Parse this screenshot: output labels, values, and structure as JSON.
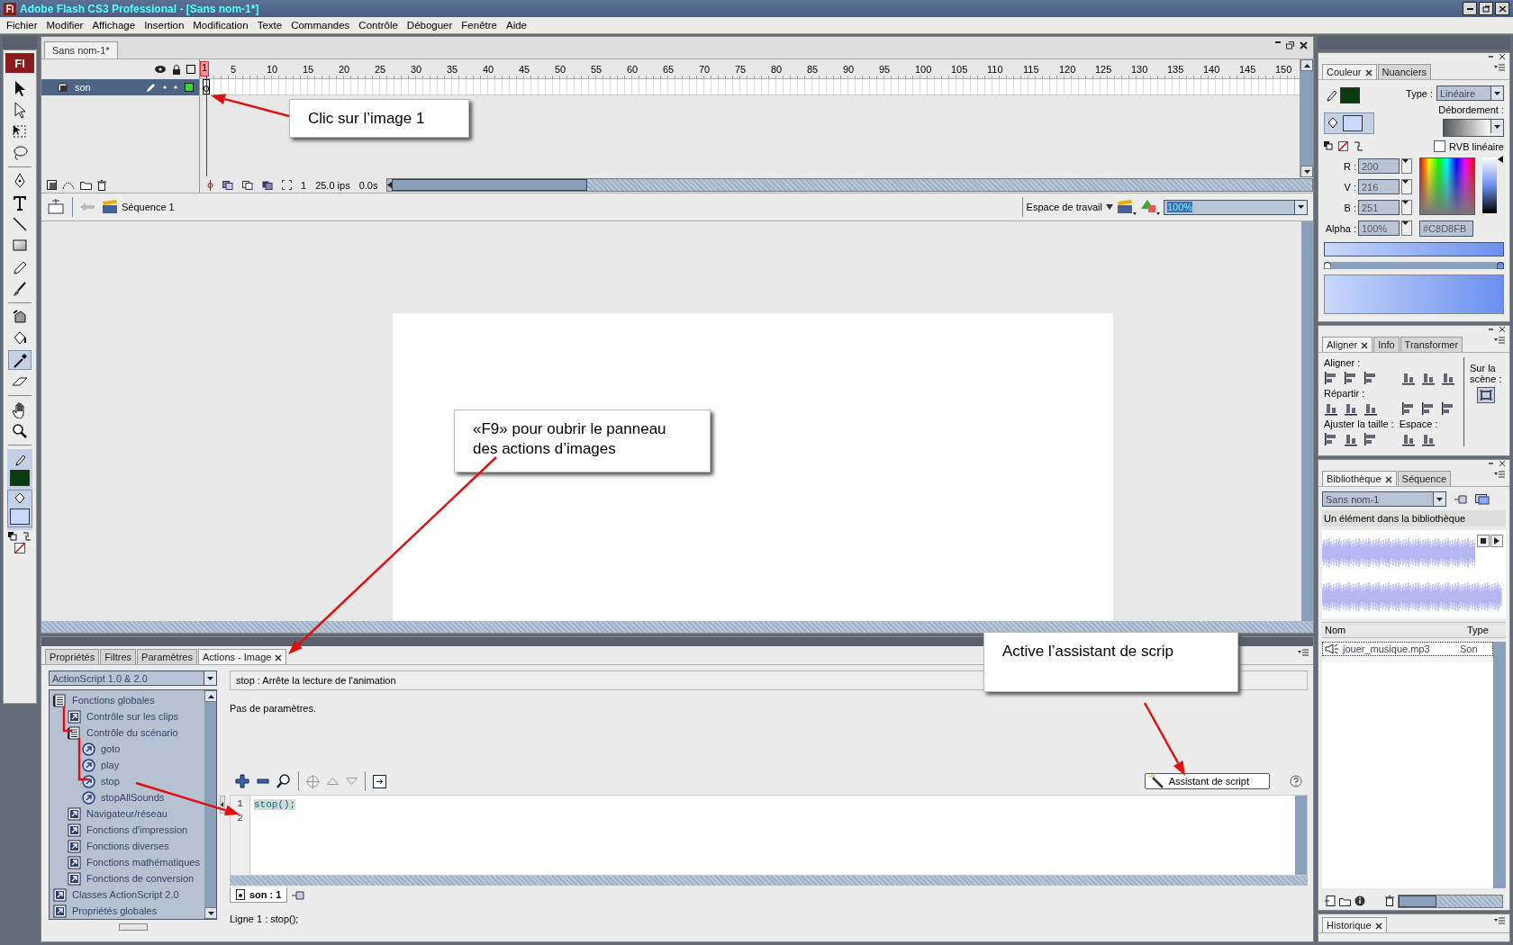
{
  "window": {
    "title": "Adobe Flash CS3 Professional - [Sans nom-1*]"
  },
  "menu": [
    "Fichier",
    "Modifier",
    "Affichage",
    "Insertion",
    "Modification",
    "Texte",
    "Commandes",
    "Contrôle",
    "Déboguer",
    "Fenêtre",
    "Aide"
  ],
  "toolbox": {
    "logo": "Fl",
    "tool_groups": [
      {
        "tools": [
          {
            "kind": "selection",
            "selected": false
          },
          {
            "kind": "subselection",
            "selected": false
          },
          {
            "kind": "transform",
            "selected": false
          },
          {
            "kind": "lasso",
            "selected": false
          }
        ]
      },
      {
        "tools": [
          {
            "kind": "pen",
            "selected": false
          },
          {
            "kind": "text",
            "selected": false
          },
          {
            "kind": "line",
            "selected": false
          },
          {
            "kind": "rectangle",
            "selected": false
          },
          {
            "kind": "pencil",
            "selected": false
          },
          {
            "kind": "brush",
            "selected": false
          }
        ]
      },
      {
        "tools": [
          {
            "kind": "inkbottle",
            "selected": false
          },
          {
            "kind": "bucket",
            "selected": false
          },
          {
            "kind": "eyedropper",
            "selected": true
          },
          {
            "kind": "eraser",
            "selected": false
          }
        ]
      },
      {
        "tools": [
          {
            "kind": "hand",
            "selected": false
          },
          {
            "kind": "zoom",
            "selected": false
          }
        ]
      }
    ],
    "swatches": [
      {
        "kind": "stroke",
        "color": "#0b3b10"
      },
      {
        "kind": "fill",
        "color": "#c8d8fb"
      }
    ]
  },
  "document": {
    "tab": "Sans nom-1*"
  },
  "timeline": {
    "ruler": [
      "1",
      "5",
      "10",
      "15",
      "20",
      "25",
      "30",
      "35",
      "40",
      "45",
      "50",
      "55",
      "60",
      "65",
      "70",
      "75",
      "80",
      "85",
      "90",
      "95",
      "100",
      "105",
      "110",
      "115",
      "120",
      "125",
      "130",
      "135",
      "140",
      "145",
      "150"
    ],
    "layers": [
      {
        "name": "son",
        "selected": true
      }
    ],
    "current_frame": "1",
    "frame_rate": "25.0 ips",
    "elapsed": "0.0s"
  },
  "edit_bar": {
    "scene": "Séquence 1",
    "workspace": "Espace de travail",
    "zoom": "100%"
  },
  "callouts": [
    {
      "text": "Clic sur l’image 1"
    },
    {
      "text": "«F9» pour oubrir le panneau des actions d’images"
    },
    {
      "text": "Active l’assistant de scrip"
    }
  ],
  "actions_panel": {
    "tabs": [
      {
        "label": "Propriétés",
        "selected": false
      },
      {
        "label": "Filtres",
        "selected": false
      },
      {
        "label": "Paramètres",
        "selected": false
      },
      {
        "label": "Actions - Image",
        "selected": true
      }
    ],
    "language": "ActionScript 1.0 & 2.0",
    "tree": [
      {
        "label": "Fonctions globales",
        "kind": "book",
        "expanded": true,
        "children": [
          {
            "label": "Contrôle sur les clips",
            "kind": "book",
            "expanded": false
          },
          {
            "label": "Contrôle du scénario",
            "kind": "book",
            "expanded": true,
            "children": [
              {
                "label": "goto",
                "kind": "action"
              },
              {
                "label": "play",
                "kind": "action"
              },
              {
                "label": "stop",
                "kind": "action"
              },
              {
                "label": "stopAllSounds",
                "kind": "action"
              }
            ]
          },
          {
            "label": "Navigateur/réseau",
            "kind": "book",
            "expanded": false
          },
          {
            "label": "Fonctions d'impression",
            "kind": "book",
            "expanded": false
          },
          {
            "label": "Fonctions diverses",
            "kind": "book",
            "expanded": false
          },
          {
            "label": "Fonctions mathématiques",
            "kind": "book",
            "expanded": false
          },
          {
            "label": "Fonctions de conversion",
            "kind": "book",
            "expanded": false
          }
        ]
      },
      {
        "label": "Classes ActionScript 2.0",
        "kind": "book",
        "expanded": false
      },
      {
        "label": "Propriétés globales",
        "kind": "book",
        "expanded": false
      }
    ],
    "description": "stop : Arrête la lecture de l'animation",
    "parameters": "Pas de paramètres.",
    "script_assist": "Assistant de script",
    "line_numbers": [
      "1",
      "2"
    ],
    "code": "stop();",
    "script_tab": "son : 1",
    "status": "Ligne 1 : stop();"
  },
  "color_panel": {
    "tabs": [
      {
        "label": "Couleur",
        "selected": true
      },
      {
        "label": "Nuanciers",
        "selected": false
      }
    ],
    "swatches": [
      {
        "kind": "stroke",
        "color": "#0b3b10"
      },
      {
        "kind": "fill",
        "color": "#c8d8fb"
      }
    ],
    "type_label": "Type :",
    "type_value": "Linéaire",
    "overflow_label": "Débordement :",
    "linear_rgb": {
      "label": "RVB linéaire",
      "checked": false
    },
    "brightness": {
      "level": 0.96
    },
    "fields": [
      {
        "label": "R :",
        "value": "200"
      },
      {
        "label": "V :",
        "value": "216"
      },
      {
        "label": "B :",
        "value": "251"
      },
      {
        "label": "Alpha :",
        "value": "100%"
      }
    ],
    "hex": "#C8D8FB"
  },
  "align_panel": {
    "tabs": [
      {
        "label": "Aligner",
        "selected": true
      },
      {
        "label": "Info",
        "selected": false
      },
      {
        "label": "Transformer",
        "selected": false
      }
    ],
    "align_label": "Aligner :",
    "distribute_label": "Répartir :",
    "match_size_label": "Ajuster la taille :",
    "space_label": "Espace :",
    "stage_label": "Sur la scène :"
  },
  "library_panel": {
    "tabs": [
      {
        "label": "Bibliothèque",
        "selected": true
      },
      {
        "label": "Séquence",
        "selected": false
      }
    ],
    "document": "Sans nom-1",
    "count": "Un élément dans la bibliothèque",
    "columns": [
      "Nom",
      "Type"
    ],
    "items": [
      {
        "name": "jouer_musique.mp3",
        "type": "Son"
      }
    ]
  },
  "history_panel": {
    "tabs": [
      {
        "label": "Historique",
        "selected": true
      }
    ]
  }
}
